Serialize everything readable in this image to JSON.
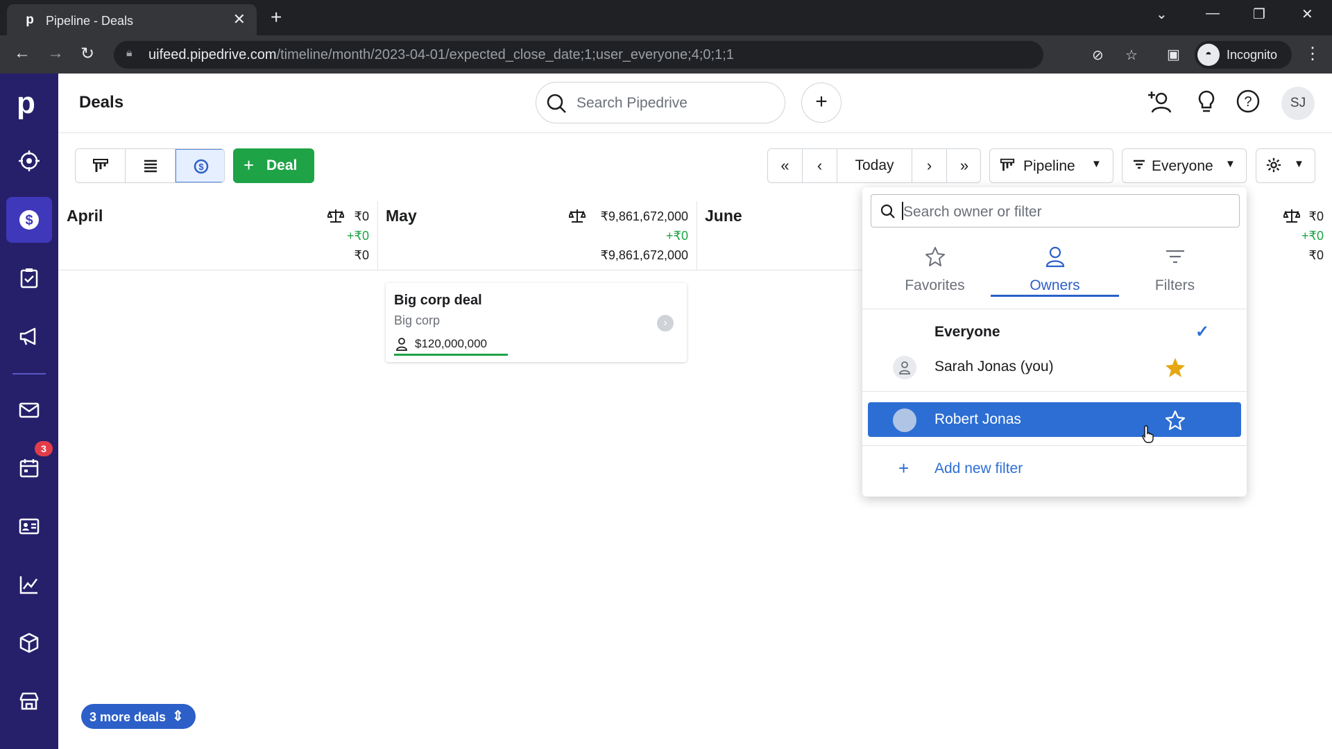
{
  "browser": {
    "tab_title": "Pipeline - Deals",
    "tab_favicon": "p",
    "url_host": "uifeed.pipedrive.com",
    "url_path": "/timeline/month/2023-04-01/expected_close_date;1;user_everyone;4;0;1;1",
    "profile_label": "Incognito"
  },
  "sidebar": {
    "logo": "p",
    "notification_badge": "3",
    "items": [
      "focus-icon",
      "deals-icon",
      "activities-icon",
      "campaigns-icon",
      "mail-icon",
      "calendar-icon",
      "contacts-icon",
      "insights-icon",
      "products-icon",
      "marketplace-icon"
    ]
  },
  "header": {
    "title": "Deals",
    "search_placeholder": "Search Pipedrive",
    "avatar_initials": "SJ"
  },
  "toolbar": {
    "deal_button": "Deal",
    "today": "Today",
    "pipeline": "Pipeline",
    "owner_filter": "Everyone"
  },
  "timeline": {
    "columns": [
      {
        "month": "April",
        "total": "₹0",
        "added": "+₹0",
        "weighted": "₹0"
      },
      {
        "month": "May",
        "total": "₹9,861,672,000",
        "added": "+₹0",
        "weighted": "₹9,861,672,000"
      },
      {
        "month": "June"
      },
      {
        "total": "₹0",
        "added": "+₹0",
        "weighted": "₹0"
      }
    ],
    "deal_card": {
      "title": "Big corp deal",
      "organization": "Big corp",
      "value": "$120,000,000"
    },
    "more_deals": "3 more deals"
  },
  "popup": {
    "search_placeholder": "Search owner or filter",
    "tabs": [
      "Favorites",
      "Owners",
      "Filters"
    ],
    "active_tab": "Owners",
    "rows": [
      {
        "name": "Everyone",
        "checked": true
      },
      {
        "name": "Sarah Jonas (you)",
        "favorite": true
      },
      {
        "name": "Robert Jonas",
        "favorite": false,
        "highlighted": true
      }
    ],
    "add_filter": "Add new filter"
  },
  "colors": {
    "sidebar_bg": "#26206b",
    "sidebar_active": "#3f38ba",
    "accent_green": "#1fa347",
    "accent_blue": "#2c6ed4",
    "star_gold": "#e5a712",
    "badge_red": "#e23c4b"
  }
}
